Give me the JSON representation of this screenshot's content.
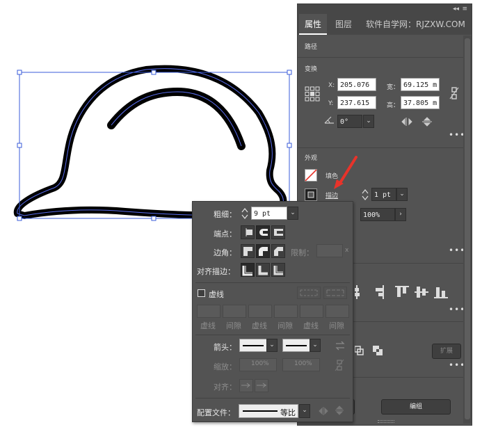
{
  "tabs": {
    "properties": "属性",
    "layers": "图层",
    "site": "软件自学网：RJZXW.COM"
  },
  "panel": {
    "collapse_glyph": "◂◂",
    "close_glyph": "≡",
    "path_label": "路径",
    "transform_label": "变换",
    "x_label": "X:",
    "x_value": "205.076",
    "y_label": "Y:",
    "y_value": "237.615",
    "width_label": "宽：",
    "width_value": "69.125 m",
    "height_label": "高：",
    "height_value": "37.805 m",
    "rotate_value": "0°",
    "appearance_label": "外观",
    "fill_label": "填色",
    "stroke_label": "描边",
    "stroke_weight_value": "1 pt",
    "opacity_value": "100%",
    "expand_button": "扩展",
    "edit_button": "编组",
    "more_glyph": "•••"
  },
  "stroke_popup": {
    "weight_label": "粗细：",
    "weight_value": "9 pt",
    "cap_label": "端点：",
    "corner_label": "边角：",
    "limit_label": "限制：",
    "limit_suffix": "x",
    "align_label": "对齐描边：",
    "dashed_label": "虚线",
    "dash_labels": [
      "虚线",
      "间隙",
      "虚线",
      "间隙",
      "虚线",
      "间隙"
    ],
    "arrow_label": "箭头：",
    "scale_label": "缩放：",
    "scale_value_1": "100%",
    "scale_value_2": "100%",
    "arrow_align_label": "对齐：",
    "profile_label": "配置文件：",
    "profile_value": "等比"
  },
  "colors": {
    "panel_bg": "#535353",
    "selection_blue": "#3a5bd8",
    "arrow_red": "#e8332a"
  }
}
